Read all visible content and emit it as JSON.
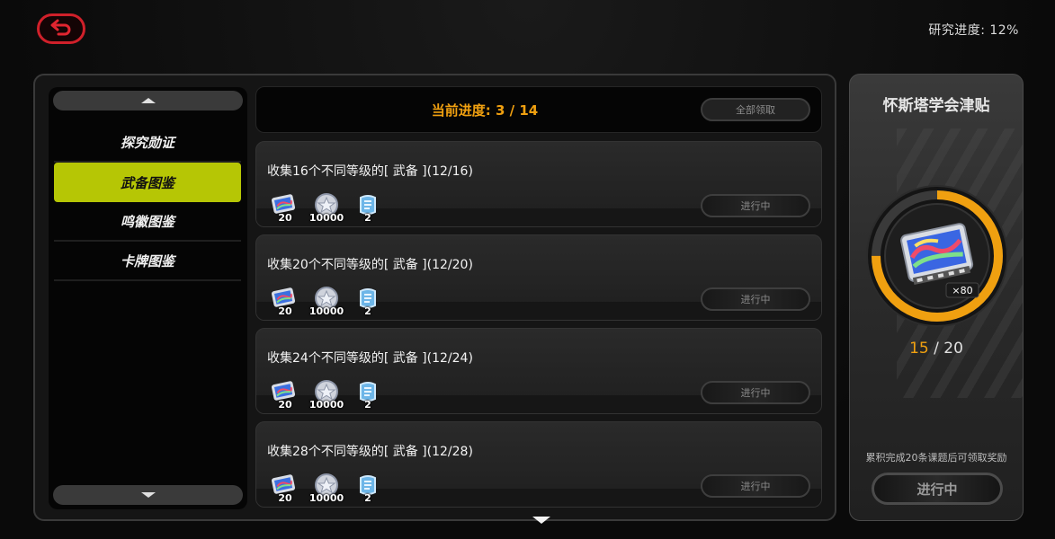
{
  "header": {
    "research_progress": "研究进度: 12%"
  },
  "sidebar": {
    "items": [
      {
        "label": "探究勋证"
      },
      {
        "label": "武备图鉴"
      },
      {
        "label": "鸣徽图鉴"
      },
      {
        "label": "卡牌图鉴"
      }
    ],
    "active_index": 1,
    "accent": "#b6c605"
  },
  "main": {
    "current_progress": "当前进度: 3 / 14",
    "claim_all_label": "全部领取",
    "tasks": [
      {
        "title": "收集16个不同等级的[ 武备 ](12/16)",
        "rewards": [
          "20",
          "10000",
          "2"
        ],
        "status": "进行中"
      },
      {
        "title": "收集20个不同等级的[ 武备 ](12/20)",
        "rewards": [
          "20",
          "10000",
          "2"
        ],
        "status": "进行中"
      },
      {
        "title": "收集24个不同等级的[ 武备 ](12/24)",
        "rewards": [
          "20",
          "10000",
          "2"
        ],
        "status": "进行中"
      },
      {
        "title": "收集28个不同等级的[ 武备 ](12/28)",
        "rewards": [
          "20",
          "10000",
          "2"
        ],
        "status": "进行中"
      }
    ]
  },
  "allowance": {
    "title": "怀斯塔学会津贴",
    "item_qty": "×80",
    "current": "15",
    "separator": " / ",
    "total": "20",
    "progress_fraction": 0.75,
    "note": "累积完成20条课题后可领取奖励",
    "status": "进行中",
    "ring_color": "#f0a010"
  }
}
